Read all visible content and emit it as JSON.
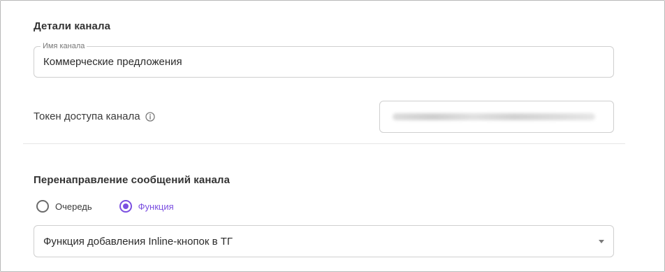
{
  "channel_details": {
    "title": "Детали канала",
    "name_field": {
      "label": "Имя канала",
      "value": "Коммерческие предложения"
    },
    "token": {
      "label": "Токен доступа канала",
      "info_icon": "info-circle-icon",
      "value_masked": true
    }
  },
  "redirect": {
    "title": "Перенаправление сообщений канала",
    "options": [
      {
        "label": "Очередь",
        "selected": false
      },
      {
        "label": "Функция",
        "selected": true
      }
    ],
    "function_select": {
      "value": "Функция добавления Inline-кнопок в ТГ",
      "icon": "caret-down-icon"
    }
  },
  "colors": {
    "accent": "#7b4fe0",
    "border": "#cfcfcf",
    "text": "#333333"
  }
}
